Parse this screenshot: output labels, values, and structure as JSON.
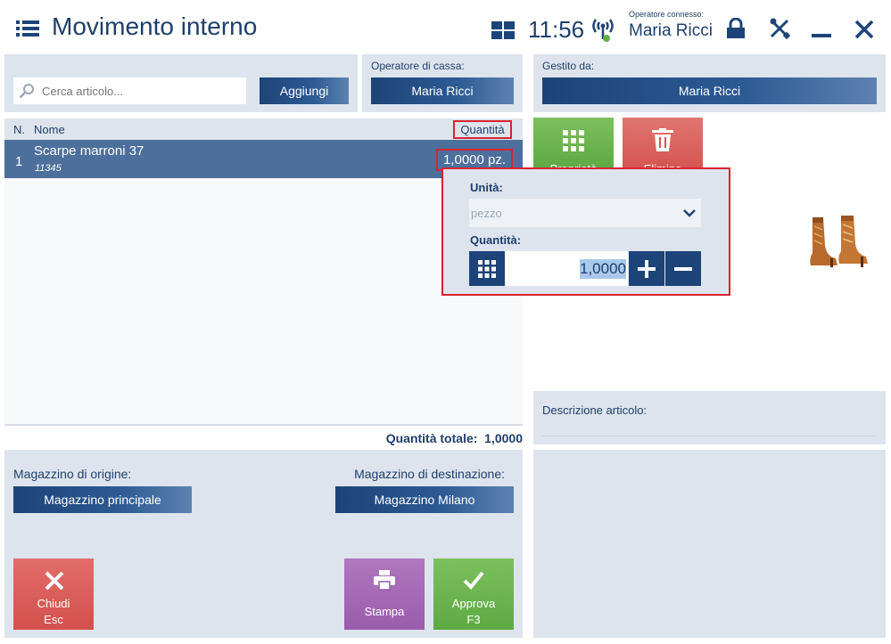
{
  "header": {
    "title": "Movimento interno",
    "time": "11:56",
    "operator_label": "Operatore connesso:",
    "operator_name": "Maria Ricci"
  },
  "search": {
    "placeholder": "Cerca articolo...",
    "add_label": "Aggiungi"
  },
  "cashier": {
    "label": "Operatore di cassa:",
    "name": "Maria Ricci"
  },
  "managed": {
    "label": "Gestito da:",
    "name": "Maria Ricci"
  },
  "table": {
    "col_n": "N.",
    "col_name": "Nome",
    "col_qty": "Quantità",
    "rows": [
      {
        "n": "1",
        "name": "Scarpe marroni 37",
        "code": "11345",
        "qty": "1,0000 pz."
      }
    ],
    "total_label": "Quantità totale:",
    "total_value": "1,0000"
  },
  "tiles": {
    "green_label": "Proprietà",
    "red_label": "Elimina"
  },
  "popup": {
    "unit_label": "Unità:",
    "unit_value": "pezzo",
    "qty_label": "Quantità:",
    "qty_value": "1,0000"
  },
  "description": {
    "label": "Descrizione articolo:"
  },
  "warehouse": {
    "origin_label": "Magazzino di origine:",
    "origin_value": "Magazzino principale",
    "dest_label": "Magazzino di destinazione:",
    "dest_value": "Magazzino Milano"
  },
  "actions": {
    "close_label": "Chiudi",
    "close_key": "Esc",
    "print_label": "Stampa",
    "approve_label": "Approva",
    "approve_key": "F3"
  },
  "colors": {
    "accent": "#1d4478",
    "panel": "#dde4ed",
    "row_selected": "#4d6f9c",
    "close": "#d9534f",
    "print": "#a062b0",
    "approve": "#63ad46",
    "highlight": "#d9232e"
  }
}
